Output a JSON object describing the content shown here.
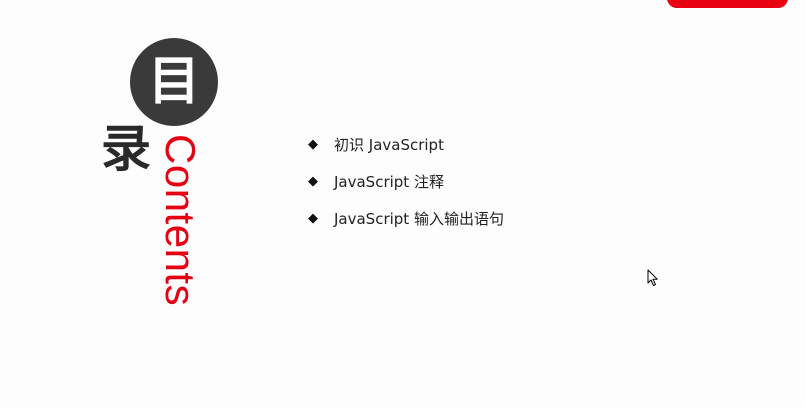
{
  "title": {
    "circle_char": "目",
    "second_char": "录",
    "english": "Contents"
  },
  "toc": {
    "bullet": "◆",
    "items": [
      {
        "label": "初识 JavaScript"
      },
      {
        "label": "JavaScript 注释"
      },
      {
        "label": "JavaScript 输入输出语句"
      }
    ]
  },
  "colors": {
    "accent": "#e60012",
    "circle": "#3a3a3a",
    "text": "#222222"
  },
  "icons": {
    "bullet": "diamond-bullet-icon",
    "cursor": "mouse-cursor-icon"
  }
}
